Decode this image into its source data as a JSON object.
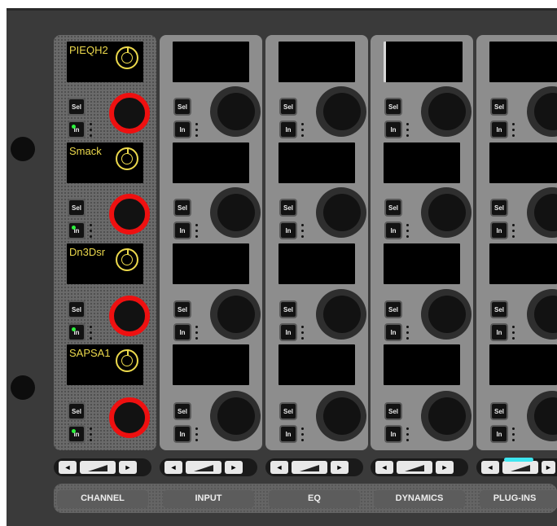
{
  "colors": {
    "panel": "#3a3a3a",
    "oled_text": "#ecd94c",
    "active_knob_ring": "#ee1010",
    "led_on": "#2cf23c",
    "nav_highlight": "#3ee6f0"
  },
  "buttons": {
    "select_label": "Sel",
    "insert_label": "In"
  },
  "channel_strip": {
    "slots": [
      {
        "name": "PIEQH2",
        "insert_on": true
      },
      {
        "name": "Smack",
        "insert_on": true
      },
      {
        "name": "Dn3Dsr",
        "insert_on": true
      },
      {
        "name": "SAPSA1",
        "insert_on": true
      }
    ]
  },
  "sections": [
    {
      "label": "CHANNEL"
    },
    {
      "label": "INPUT"
    },
    {
      "label": "EQ"
    },
    {
      "label": "DYNAMICS"
    },
    {
      "label": "PLUG-INS"
    }
  ],
  "nav": {
    "left_glyph": "◄",
    "right_glyph": "►",
    "icons": [
      "left-arrow-icon",
      "ramp-icon",
      "right-arrow-icon"
    ]
  }
}
